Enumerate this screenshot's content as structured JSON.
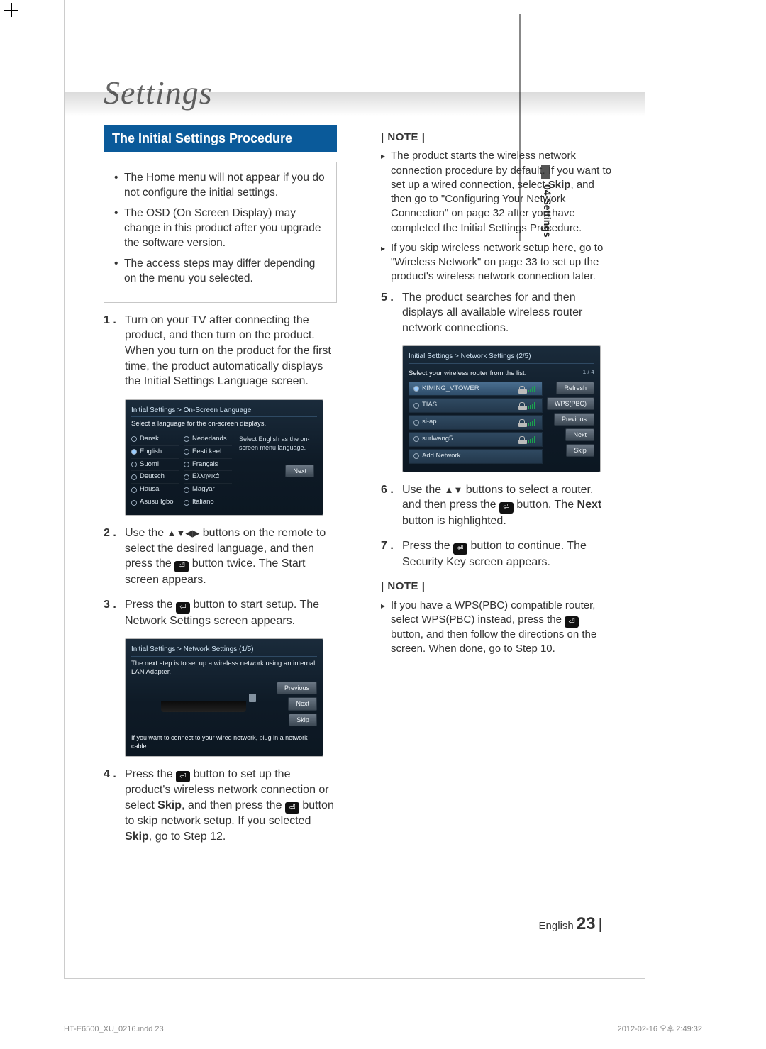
{
  "title": "Settings",
  "side_tab": "04  Settings",
  "section_header": "The Initial Settings Procedure",
  "intro_bullets": [
    "The Home menu will not appear if you do not configure the initial settings.",
    "The OSD (On Screen Display) may change in this product after you upgrade the software version.",
    "The access steps may differ depending on the menu you selected."
  ],
  "steps_left": [
    {
      "n": "1 .",
      "t": "Turn on your TV after connecting the product, and then turn on the product. When you turn on the product for the first time, the product automatically displays the Initial Settings Language screen."
    },
    {
      "n": "2 .",
      "t_pre": "Use the ",
      "arrows": "▲▼◀▶",
      "t_mid": " buttons on the remote to select the desired language, and then press the ",
      "t_post": " button twice. The Start screen appears."
    },
    {
      "n": "3 .",
      "t_pre": "Press the ",
      "t_post": " button to start setup. The Network Settings screen appears."
    },
    {
      "n": "4 .",
      "t_pre": "Press the ",
      "t_mid": " button to set up the product's wireless network connection or select ",
      "bold1": "Skip",
      "t_mid2": ", and then press the ",
      "t_post": " button to skip network setup. If you selected ",
      "bold2": "Skip",
      "t_end": ", go to Step 12."
    }
  ],
  "note1_header": "| NOTE |",
  "note1_items": [
    {
      "pre": "The product starts the wireless network connection procedure by default. If you want to set up a wired connection, select ",
      "b": "Skip",
      "post": ", and then go to \"Configuring Your Network Connection\" on page 32 after you have completed the Initial Settings Procedure."
    },
    {
      "pre": "If you skip wireless network setup here, go to \"Wireless Network\" on page 33 to set up the product's wireless network connection later.",
      "b": "",
      "post": ""
    }
  ],
  "steps_right": [
    {
      "n": "5 .",
      "t": "The product searches for and then displays all available wireless router network connections."
    },
    {
      "n": "6 .",
      "t_pre": "Use the ",
      "arrows": "▲▼",
      "t_mid": " buttons to select a router, and then press the ",
      "t_mid2": " button. The ",
      "bold": "Next",
      "t_post": " button is highlighted."
    },
    {
      "n": "7 .",
      "t_pre": "Press the ",
      "t_post": " button to continue. The Security Key screen appears."
    }
  ],
  "note2_header": "| NOTE |",
  "note2_items": [
    {
      "pre": "If you have a WPS(PBC) compatible router, select WPS(PBC) instead, press the ",
      "post": " button, and then follow the directions on the screen. When done, go to Step 10."
    }
  ],
  "ss1": {
    "crumb": "Initial Settings > On-Screen Language",
    "hint": "Select a language for the on-screen displays.",
    "side": "Select English as the on-screen menu language.",
    "col1": [
      "Dansk",
      "English",
      "Suomi",
      "Deutsch",
      "Hausa",
      "Asusu Igbo"
    ],
    "col2": [
      "Nederlands",
      "Eesti keel",
      "Français",
      "Ελληνικά",
      "Magyar",
      "Italiano"
    ],
    "selected": "English",
    "next": "Next"
  },
  "ss2": {
    "crumb": "Initial Settings > Network Settings (1/5)",
    "hint": "The next step is to set up a wireless network using an internal LAN Adapter.",
    "foot": "If you want to connect to your wired network, plug in a network cable.",
    "btns": [
      "Previous",
      "Next",
      "Skip"
    ]
  },
  "ss3": {
    "crumb": "Initial Settings > Network Settings (2/5)",
    "hint": "Select your wireless router from the list.",
    "page": "1 / 4",
    "rows": [
      "KIMING_VTOWER",
      "TIAS",
      "si-ap",
      "surlwang5",
      "Add Network"
    ],
    "selected": "KIMING_VTOWER",
    "btns": [
      "Refresh",
      "WPS(PBC)",
      "Previous",
      "Next",
      "Skip"
    ]
  },
  "footer": {
    "lang": "English",
    "page": "23"
  },
  "print": {
    "left": "HT-E6500_XU_0216.indd   23",
    "right": "2012-02-16   오후 2:49:32"
  }
}
